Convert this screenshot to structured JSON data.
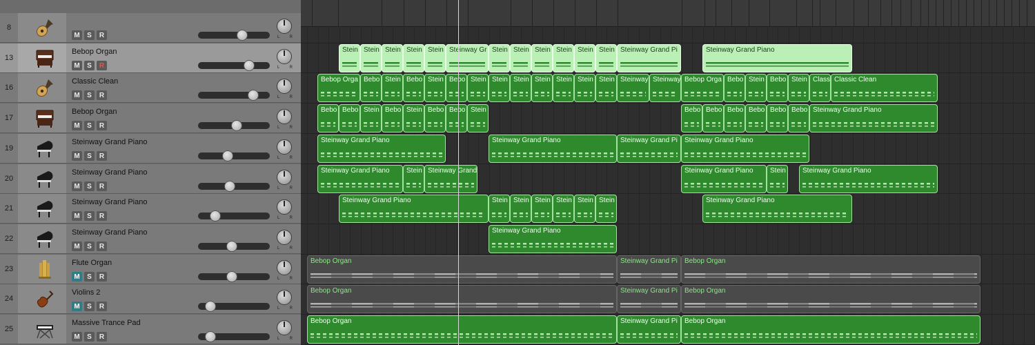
{
  "tracks": [
    {
      "num": "8",
      "name": "",
      "icon": "guitar-icon",
      "mute": false,
      "solo": false,
      "rec": false,
      "volume": 0.62,
      "selected": false
    },
    {
      "num": "13",
      "name": "Bebop Organ",
      "icon": "organ-icon",
      "mute": false,
      "solo": false,
      "rec": true,
      "volume": 0.71,
      "selected": true
    },
    {
      "num": "16",
      "name": "Classic Clean",
      "icon": "guitar-icon",
      "mute": false,
      "solo": false,
      "rec": false,
      "volume": 0.77,
      "selected": false
    },
    {
      "num": "17",
      "name": "Bebop Organ",
      "icon": "organ-icon",
      "mute": false,
      "solo": false,
      "rec": false,
      "volume": 0.54,
      "selected": false
    },
    {
      "num": "19",
      "name": "Steinway Grand Piano",
      "icon": "grand-piano-icon",
      "mute": false,
      "solo": false,
      "rec": false,
      "volume": 0.41,
      "selected": false
    },
    {
      "num": "20",
      "name": "Steinway Grand Piano",
      "icon": "grand-piano-icon",
      "mute": false,
      "solo": false,
      "rec": false,
      "volume": 0.44,
      "selected": false
    },
    {
      "num": "21",
      "name": "Steinway Grand Piano",
      "icon": "grand-piano-icon",
      "mute": false,
      "solo": false,
      "rec": false,
      "volume": 0.24,
      "selected": false
    },
    {
      "num": "22",
      "name": "Steinway Grand Piano",
      "icon": "grand-piano-icon",
      "mute": false,
      "solo": false,
      "rec": false,
      "volume": 0.47,
      "selected": false
    },
    {
      "num": "23",
      "name": "Flute Organ",
      "icon": "organ-pipes-icon",
      "mute": true,
      "solo": false,
      "rec": false,
      "volume": 0.47,
      "selected": false
    },
    {
      "num": "24",
      "name": "Violins 2",
      "icon": "violin-icon",
      "mute": true,
      "solo": false,
      "rec": false,
      "volume": 0.17,
      "selected": false
    },
    {
      "num": "25",
      "name": "Massive Trance Pad",
      "icon": "keyboard-icon",
      "mute": false,
      "solo": false,
      "rec": false,
      "volume": 0.17,
      "selected": false
    }
  ],
  "button_labels": {
    "mute": "M",
    "solo": "S",
    "rec": "R",
    "pan_left": "L",
    "pan_right": "R"
  },
  "regions": [
    {
      "lane": 1,
      "start": 491,
      "end": 522,
      "label": "Stein",
      "style": "light"
    },
    {
      "lane": 1,
      "start": 522,
      "end": 553,
      "label": "Stein",
      "style": "light"
    },
    {
      "lane": 1,
      "start": 553,
      "end": 584,
      "label": "Stein",
      "style": "light"
    },
    {
      "lane": 1,
      "start": 584,
      "end": 615,
      "label": "Stein",
      "style": "light"
    },
    {
      "lane": 1,
      "start": 615,
      "end": 646,
      "label": "Stein",
      "style": "light"
    },
    {
      "lane": 1,
      "start": 646,
      "end": 708,
      "label": "Steinway Gr",
      "style": "light"
    },
    {
      "lane": 1,
      "start": 708,
      "end": 739,
      "label": "Stein",
      "style": "light"
    },
    {
      "lane": 1,
      "start": 739,
      "end": 770,
      "label": "Stein",
      "style": "light"
    },
    {
      "lane": 1,
      "start": 770,
      "end": 801,
      "label": "Stein",
      "style": "light"
    },
    {
      "lane": 1,
      "start": 801,
      "end": 832,
      "label": "Stein",
      "style": "light"
    },
    {
      "lane": 1,
      "start": 832,
      "end": 863,
      "label": "Stein",
      "style": "light"
    },
    {
      "lane": 1,
      "start": 863,
      "end": 894,
      "label": "Stein",
      "style": "light"
    },
    {
      "lane": 1,
      "start": 894,
      "end": 987,
      "label": "Steinway Grand Pi",
      "style": "light"
    },
    {
      "lane": 1,
      "start": 1018,
      "end": 1235,
      "label": "Steinway Grand Piano",
      "style": "light"
    },
    {
      "lane": 2,
      "start": 460,
      "end": 522,
      "label": "Bebop Orga",
      "style": "green"
    },
    {
      "lane": 2,
      "start": 522,
      "end": 553,
      "label": "Bebo",
      "style": "green"
    },
    {
      "lane": 2,
      "start": 553,
      "end": 584,
      "label": "Stein",
      "style": "green"
    },
    {
      "lane": 2,
      "start": 584,
      "end": 615,
      "label": "Bebo",
      "style": "green"
    },
    {
      "lane": 2,
      "start": 615,
      "end": 646,
      "label": "Stein",
      "style": "green"
    },
    {
      "lane": 2,
      "start": 646,
      "end": 677,
      "label": "Bebo",
      "style": "green"
    },
    {
      "lane": 2,
      "start": 677,
      "end": 708,
      "label": "Stein",
      "style": "green"
    },
    {
      "lane": 2,
      "start": 708,
      "end": 739,
      "label": "Stein",
      "style": "green"
    },
    {
      "lane": 2,
      "start": 739,
      "end": 770,
      "label": "Stein",
      "style": "green"
    },
    {
      "lane": 2,
      "start": 770,
      "end": 801,
      "label": "Stein",
      "style": "green"
    },
    {
      "lane": 2,
      "start": 801,
      "end": 832,
      "label": "Stein",
      "style": "green"
    },
    {
      "lane": 2,
      "start": 832,
      "end": 863,
      "label": "Stein",
      "style": "green"
    },
    {
      "lane": 2,
      "start": 863,
      "end": 894,
      "label": "Stein",
      "style": "green"
    },
    {
      "lane": 2,
      "start": 894,
      "end": 941,
      "label": "Steinway",
      "style": "green"
    },
    {
      "lane": 2,
      "start": 941,
      "end": 987,
      "label": "Steinway",
      "style": "green"
    },
    {
      "lane": 2,
      "start": 987,
      "end": 1049,
      "label": "Bebop Orga",
      "style": "green"
    },
    {
      "lane": 2,
      "start": 1049,
      "end": 1080,
      "label": "Bebo",
      "style": "green"
    },
    {
      "lane": 2,
      "start": 1080,
      "end": 1111,
      "label": "Stein",
      "style": "green"
    },
    {
      "lane": 2,
      "start": 1111,
      "end": 1142,
      "label": "Bebo",
      "style": "green"
    },
    {
      "lane": 2,
      "start": 1142,
      "end": 1173,
      "label": "Stein",
      "style": "green"
    },
    {
      "lane": 2,
      "start": 1173,
      "end": 1204,
      "label": "Class",
      "style": "green"
    },
    {
      "lane": 2,
      "start": 1204,
      "end": 1359,
      "label": "Classic Clean",
      "style": "green"
    },
    {
      "lane": 3,
      "start": 460,
      "end": 491,
      "label": "Bebo",
      "style": "green"
    },
    {
      "lane": 3,
      "start": 491,
      "end": 522,
      "label": "Bebo",
      "style": "green"
    },
    {
      "lane": 3,
      "start": 522,
      "end": 553,
      "label": "Stein",
      "style": "green"
    },
    {
      "lane": 3,
      "start": 553,
      "end": 584,
      "label": "Bebo",
      "style": "green"
    },
    {
      "lane": 3,
      "start": 584,
      "end": 615,
      "label": "Stein",
      "style": "green"
    },
    {
      "lane": 3,
      "start": 615,
      "end": 646,
      "label": "Bebo",
      "style": "green"
    },
    {
      "lane": 3,
      "start": 646,
      "end": 677,
      "label": "Bebo",
      "style": "green"
    },
    {
      "lane": 3,
      "start": 677,
      "end": 708,
      "label": "Stein",
      "style": "green"
    },
    {
      "lane": 3,
      "start": 987,
      "end": 1018,
      "label": "Bebo",
      "style": "green"
    },
    {
      "lane": 3,
      "start": 1018,
      "end": 1049,
      "label": "Bebo",
      "style": "green"
    },
    {
      "lane": 3,
      "start": 1049,
      "end": 1080,
      "label": "Bebo",
      "style": "green"
    },
    {
      "lane": 3,
      "start": 1080,
      "end": 1111,
      "label": "Bebo",
      "style": "green"
    },
    {
      "lane": 3,
      "start": 1111,
      "end": 1142,
      "label": "Bebo",
      "style": "green"
    },
    {
      "lane": 3,
      "start": 1142,
      "end": 1173,
      "label": "Bebo",
      "style": "green"
    },
    {
      "lane": 3,
      "start": 1173,
      "end": 1359,
      "label": "Steinway Grand Piano",
      "style": "green"
    },
    {
      "lane": 4,
      "start": 460,
      "end": 646,
      "label": "Steinway Grand Piano",
      "style": "green"
    },
    {
      "lane": 4,
      "start": 708,
      "end": 894,
      "label": "Steinway Grand Piano",
      "style": "green"
    },
    {
      "lane": 4,
      "start": 894,
      "end": 987,
      "label": "Steinway Grand Pi",
      "style": "green"
    },
    {
      "lane": 4,
      "start": 987,
      "end": 1173,
      "label": "Steinway Grand Piano",
      "style": "green"
    },
    {
      "lane": 5,
      "start": 460,
      "end": 584,
      "label": "Steinway Grand Piano",
      "style": "green"
    },
    {
      "lane": 5,
      "start": 584,
      "end": 615,
      "label": "Stein",
      "style": "green"
    },
    {
      "lane": 5,
      "start": 615,
      "end": 692,
      "label": "Steinway Grand",
      "style": "green"
    },
    {
      "lane": 5,
      "start": 987,
      "end": 1111,
      "label": "Steinway Grand Piano",
      "style": "green"
    },
    {
      "lane": 5,
      "start": 1111,
      "end": 1142,
      "label": "Stein",
      "style": "green"
    },
    {
      "lane": 5,
      "start": 1158,
      "end": 1359,
      "label": "Steinway Grand Piano",
      "style": "green"
    },
    {
      "lane": 6,
      "start": 491,
      "end": 708,
      "label": "Steinway Grand Piano",
      "style": "green"
    },
    {
      "lane": 6,
      "start": 708,
      "end": 739,
      "label": "Stein",
      "style": "green"
    },
    {
      "lane": 6,
      "start": 739,
      "end": 770,
      "label": "Stein",
      "style": "green"
    },
    {
      "lane": 6,
      "start": 770,
      "end": 801,
      "label": "Stein",
      "style": "green"
    },
    {
      "lane": 6,
      "start": 801,
      "end": 832,
      "label": "Stein",
      "style": "green"
    },
    {
      "lane": 6,
      "start": 832,
      "end": 863,
      "label": "Stein",
      "style": "green"
    },
    {
      "lane": 6,
      "start": 863,
      "end": 894,
      "label": "Stein",
      "style": "green"
    },
    {
      "lane": 6,
      "start": 1018,
      "end": 1235,
      "label": "Steinway Grand Piano",
      "style": "green"
    },
    {
      "lane": 7,
      "start": 708,
      "end": 894,
      "label": "Steinway Grand Piano",
      "style": "green"
    },
    {
      "lane": 8,
      "start": 445,
      "end": 894,
      "label": "Bebop Organ",
      "style": "grey"
    },
    {
      "lane": 8,
      "start": 894,
      "end": 987,
      "label": "Steinway Grand Pi",
      "style": "grey"
    },
    {
      "lane": 8,
      "start": 987,
      "end": 1421,
      "label": "Bebop Organ",
      "style": "grey"
    },
    {
      "lane": 9,
      "start": 445,
      "end": 894,
      "label": "Bebop Organ",
      "style": "grey"
    },
    {
      "lane": 9,
      "start": 894,
      "end": 987,
      "label": "Steinway Grand Pi",
      "style": "grey"
    },
    {
      "lane": 9,
      "start": 987,
      "end": 1421,
      "label": "Bebop Organ",
      "style": "grey"
    },
    {
      "lane": 10,
      "start": 445,
      "end": 894,
      "label": "Bebop Organ",
      "style": "green"
    },
    {
      "lane": 10,
      "start": 894,
      "end": 987,
      "label": "Steinway Grand Pi",
      "style": "green"
    },
    {
      "lane": 10,
      "start": 987,
      "end": 1421,
      "label": "Bebop Organ",
      "style": "green"
    }
  ]
}
